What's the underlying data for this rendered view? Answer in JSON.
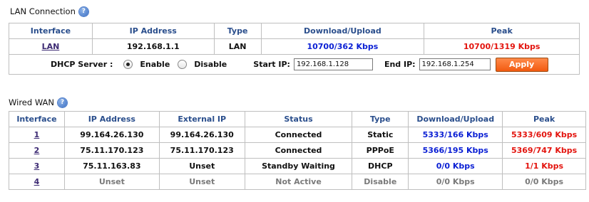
{
  "lan": {
    "title": "LAN Connection",
    "headers": {
      "interface": "Interface",
      "ip": "IP Address",
      "type": "Type",
      "dlul": "Download/Upload",
      "peak": "Peak"
    },
    "row": {
      "interface": "LAN",
      "ip": "192.168.1.1",
      "type": "LAN",
      "dlul": "10700/362 Kbps",
      "peak": "10700/1319 Kbps"
    },
    "dhcp": {
      "label": "DHCP Server :",
      "enable_label": "Enable",
      "disable_label": "Disable",
      "start_label": "Start IP:",
      "start_value": "192.168.1.128",
      "end_label": "End IP:",
      "end_value": "192.168.1.254",
      "apply_label": "Apply"
    }
  },
  "wan": {
    "title": "Wired WAN",
    "headers": {
      "interface": "Interface",
      "ip": "IP Address",
      "external_ip": "External IP",
      "status": "Status",
      "type": "Type",
      "dlul": "Download/Upload",
      "peak": "Peak"
    },
    "rows": [
      {
        "interface": "1",
        "ip": "99.164.26.130",
        "external_ip": "99.164.26.130",
        "status": "Connected",
        "type": "Static",
        "dlul": "5333/166 Kbps",
        "peak": "5333/609 Kbps"
      },
      {
        "interface": "2",
        "ip": "75.11.170.123",
        "external_ip": "75.11.170.123",
        "status": "Connected",
        "type": "PPPoE",
        "dlul": "5366/195 Kbps",
        "peak": "5369/747 Kbps"
      },
      {
        "interface": "3",
        "ip": "75.11.163.83",
        "external_ip": "Unset",
        "status": "Standby Waiting",
        "type": "DHCP",
        "dlul": "0/0 Kbps",
        "peak": "1/1 Kbps"
      },
      {
        "interface": "4",
        "ip": "Unset",
        "external_ip": "Unset",
        "status": "Not Active",
        "type": "Disable",
        "dlul": "0/0 Kbps",
        "peak": "0/0 Kbps"
      }
    ]
  },
  "colors": {
    "header_text": "#2a4e8c",
    "rate_blue": "#0a1fd4",
    "peak_red": "#e3140e",
    "inactive_gray": "#7a7a7a",
    "apply_orange": "#f25a10"
  }
}
